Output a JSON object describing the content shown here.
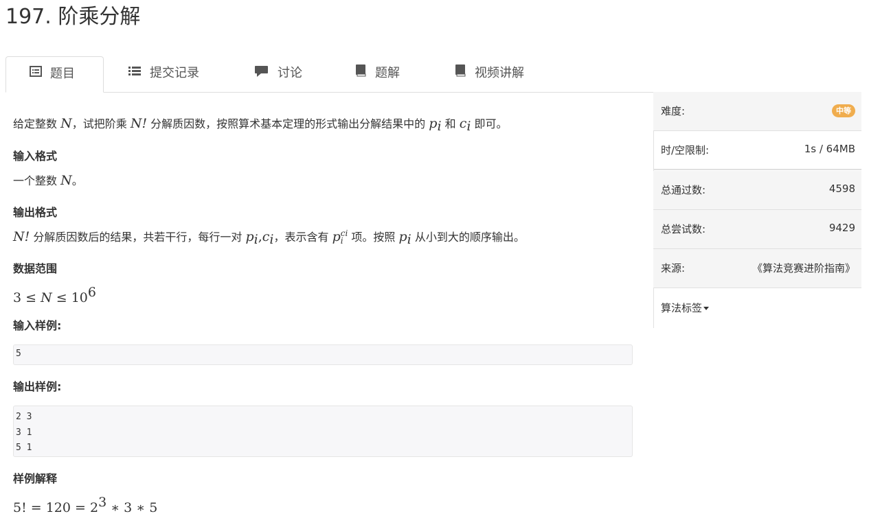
{
  "problem": {
    "title": "197. 阶乘分解"
  },
  "tabs": [
    {
      "label": "题目",
      "icon": "list-alt-icon"
    },
    {
      "label": "提交记录",
      "icon": "list-icon"
    },
    {
      "label": "讨论",
      "icon": "comment-icon"
    },
    {
      "label": "题解",
      "icon": "book-icon"
    },
    {
      "label": "视频讲解",
      "icon": "book-icon"
    }
  ],
  "description": {
    "p1_a": "给定整数 ",
    "p1_N": "N",
    "p1_b": "，试把阶乘 ",
    "p1_Nf": "N!",
    "p1_c": " 分解质因数，按照算术基本定理的形式输出分解结果中的 ",
    "p1_p": "p",
    "p1_pi": "i",
    "p1_d": " 和 ",
    "p1_cc": "c",
    "p1_ci": "i",
    "p1_e": " 即可。",
    "input_heading": "输入格式",
    "input_a": "一个整数 ",
    "input_N": "N",
    "input_b": "。",
    "output_heading": "输出格式",
    "output_Nf": "N!",
    "output_a": " 分解质因数后的结果，共若干行，每行一对 ",
    "output_pc": "p",
    "output_pc_i": "i",
    "output_comma": ",",
    "output_c": "c",
    "output_c_i": "i",
    "output_b": "，表示含有 ",
    "output_p2": "p",
    "output_p2_sup": "ci",
    "output_p2_sub": "i",
    "output_c2": " 项。按照 ",
    "output_p3": "p",
    "output_p3_i": "i",
    "output_d": " 从小到大的顺序输出。",
    "range_heading": "数据范围",
    "range_a": "3 ≤ ",
    "range_N": "N",
    "range_b": " ≤ 10",
    "range_exp": "6",
    "sample_in_heading": "输入样例:",
    "sample_in": [
      "5"
    ],
    "sample_out_heading": "输出样例:",
    "sample_out": [
      "2 3",
      "3 1",
      "5 1"
    ],
    "explain_heading": "样例解释",
    "explain_a": "5! = 120 = 2",
    "explain_exp": "3",
    "explain_b": " ∗ 3 ∗ 5"
  },
  "sidebar": {
    "difficulty_label": "难度:",
    "difficulty_value": "中等",
    "limit_label": "时/空限制:",
    "limit_value": "1s / 64MB",
    "passed_label": "总通过数:",
    "passed_value": "4598",
    "tried_label": "总尝试数:",
    "tried_value": "9429",
    "source_label": "来源:",
    "source_value": "《算法竞赛进阶指南》",
    "tags_label": "算法标签"
  },
  "colors": {
    "badge": "#f0ad4e",
    "code_bg": "#f7f7f9"
  }
}
